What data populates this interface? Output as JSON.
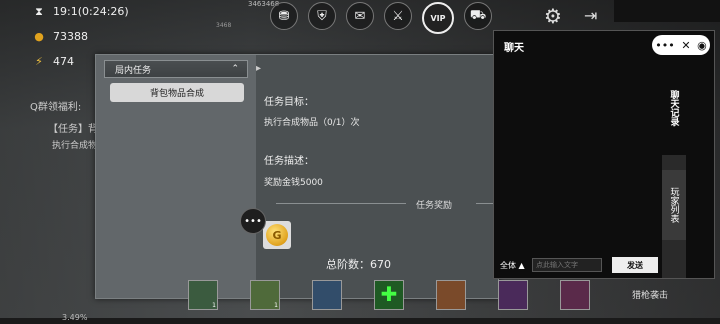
{
  "hud": {
    "time": "19:1(0:24:26)",
    "gold": "73388",
    "energy": "474",
    "top_number": "3463468",
    "small_number": "3468",
    "vip_label": "VIP",
    "quest_welfare": "Q群领福利:",
    "task_tag": "【任务】背",
    "task_exec": "执行合成物",
    "progress_pct": "3.49%",
    "shoot_label": "猎枪袭击"
  },
  "task_panel": {
    "category": "局内任务",
    "selected_task": "背包物品合成",
    "goal_title": "任务目标：",
    "goal_text": "执行合成物品（0/1）次",
    "desc_title": "任务描述：",
    "desc_text": "奖励金钱5000",
    "reward_title": "任务奖励",
    "total_label": "总阶数：670"
  },
  "skills": [
    {
      "name": "green-crystal",
      "count": "1",
      "color": "#3b5b3f"
    },
    {
      "name": "chest",
      "count": "1",
      "color": "#4f6a3a"
    },
    {
      "name": "turret",
      "count": "",
      "color": "#324d6a"
    },
    {
      "name": "heal",
      "count": "",
      "color": "#1f5a24"
    },
    {
      "name": "soldier-orange",
      "count": "",
      "color": "#7a4a2a"
    },
    {
      "name": "soldier-purple",
      "count": "",
      "color": "#4a2a5a"
    },
    {
      "name": "soldier-pink",
      "count": "",
      "color": "#5a2a4a"
    }
  ],
  "chat": {
    "title": "聊天",
    "tab_records": "聊天记录",
    "tab_players": "玩家列表",
    "channel": "全体 ▲",
    "input_placeholder": "点此输入文字",
    "send_label": "发送"
  }
}
